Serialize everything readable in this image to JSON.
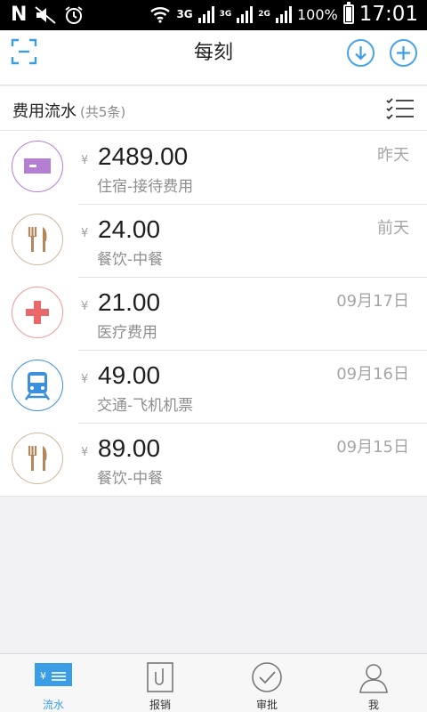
{
  "status_bar": {
    "network_3g_a": "3G",
    "network_3g_b": "3G",
    "network_2g": "2G",
    "battery": "100%",
    "time": "17:01"
  },
  "header": {
    "title": "每刻"
  },
  "section": {
    "title": "费用流水",
    "count": "(共5条)"
  },
  "currency_symbol": "¥",
  "expenses": [
    {
      "amount": "2489.00",
      "category": "住宿-接待费用",
      "date": "昨天",
      "icon": "hotel-card-icon",
      "color": "#b47fd3"
    },
    {
      "amount": "24.00",
      "category": "餐饮-中餐",
      "date": "前天",
      "icon": "fork-knife-icon",
      "color": "#b3875a"
    },
    {
      "amount": "21.00",
      "category": "医疗费用",
      "date": "09月17日",
      "icon": "medical-cross-icon",
      "color": "#e9696a"
    },
    {
      "amount": "49.00",
      "category": "交通-飞机机票",
      "date": "09月16日",
      "icon": "train-icon",
      "color": "#3b8fdb"
    },
    {
      "amount": "89.00",
      "category": "餐饮-中餐",
      "date": "09月15日",
      "icon": "fork-knife-icon",
      "color": "#b3875a"
    }
  ],
  "tabs": [
    {
      "label": "流水",
      "icon": "ledger-icon",
      "active": true
    },
    {
      "label": "报销",
      "icon": "reimburse-icon",
      "active": false
    },
    {
      "label": "审批",
      "icon": "approve-check-icon",
      "active": false
    },
    {
      "label": "我",
      "icon": "person-icon",
      "active": false
    }
  ],
  "colors": {
    "accent": "#3a9de6",
    "tab_active": "#3a9de6"
  }
}
